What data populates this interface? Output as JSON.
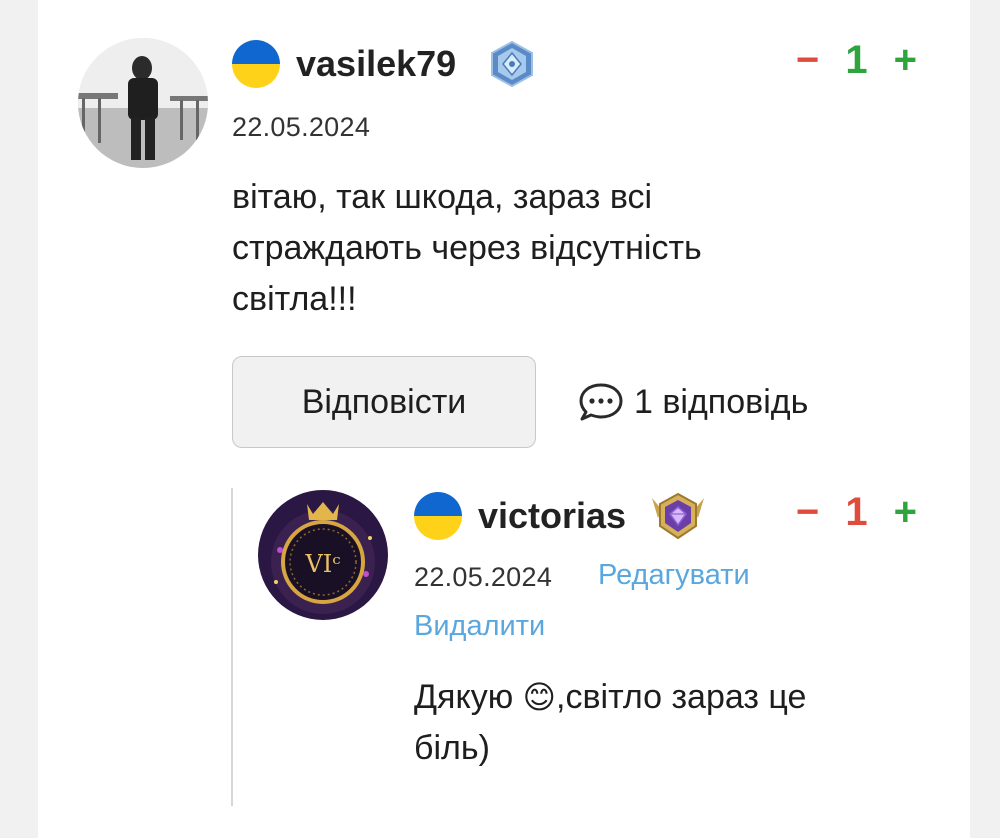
{
  "comment": {
    "username": "vasilek79",
    "date": "22.05.2024",
    "score": "1",
    "minus_label": "−",
    "plus_label": "+",
    "text_lines": [
      "вітаю, так шкода, зараз всі",
      "страждають через відсутність",
      "світла!!!"
    ],
    "reply_button": "Відповісти",
    "replies_count_label": "1 відповідь"
  },
  "reply": {
    "username": "victorias",
    "date": "22.05.2024",
    "score": "1",
    "minus_label": "−",
    "plus_label": "+",
    "edit_label": "Редагувати",
    "delete_label": "Видалити",
    "avatar_text": "VIᶜ",
    "text_line1_before": "Дякую ",
    "emoji": "😊",
    "text_line1_after": ",світло зараз це",
    "text_line2": "біль)"
  },
  "colors": {
    "vote_minus": "#e04b3c",
    "score_positive": "#2ea43c",
    "score_negative": "#e04b3c",
    "link": "#5aa7df",
    "flag_blue": "#0f67cf",
    "flag_yellow": "#ffd21a"
  }
}
